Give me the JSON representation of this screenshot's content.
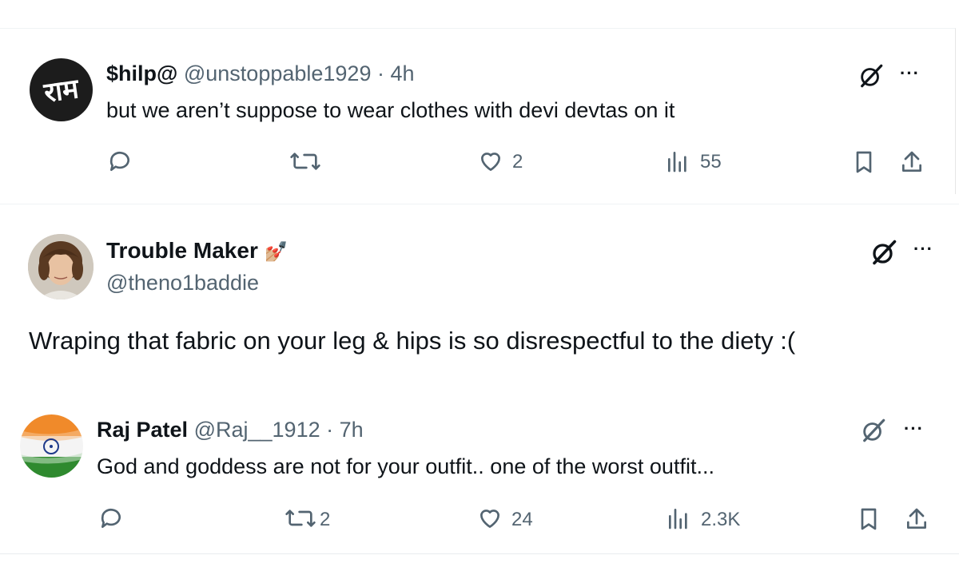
{
  "tweets": [
    {
      "avatar_text": "राम",
      "name": "$hilp@",
      "handle": "@unstoppable1929",
      "sep": "·",
      "time": "4h",
      "text": "but we aren’t suppose to wear clothes with devi devtas on it",
      "likes": "2",
      "views": "55"
    },
    {
      "name": "Trouble Maker",
      "name_emoji": "💅🏼",
      "handle": "@theno1baddie",
      "text": "Wraping that fabric on your leg & hips is so disrespectful to the diety  :("
    },
    {
      "name": "Raj Patel",
      "handle": "@Raj__1912",
      "sep": "·",
      "time": "7h",
      "text": "God and goddess are not for your outfit.. one of the worst outfit...",
      "retweets": "2",
      "likes": "24",
      "views": "2.3K"
    }
  ],
  "icons": {
    "reply": "reply-icon",
    "retweet": "retweet-icon",
    "like": "heart-icon",
    "views": "views-icon",
    "bookmark": "bookmark-icon",
    "share": "share-icon",
    "grok": "grok-icon",
    "more": "more-icon"
  },
  "more_glyph": "···"
}
